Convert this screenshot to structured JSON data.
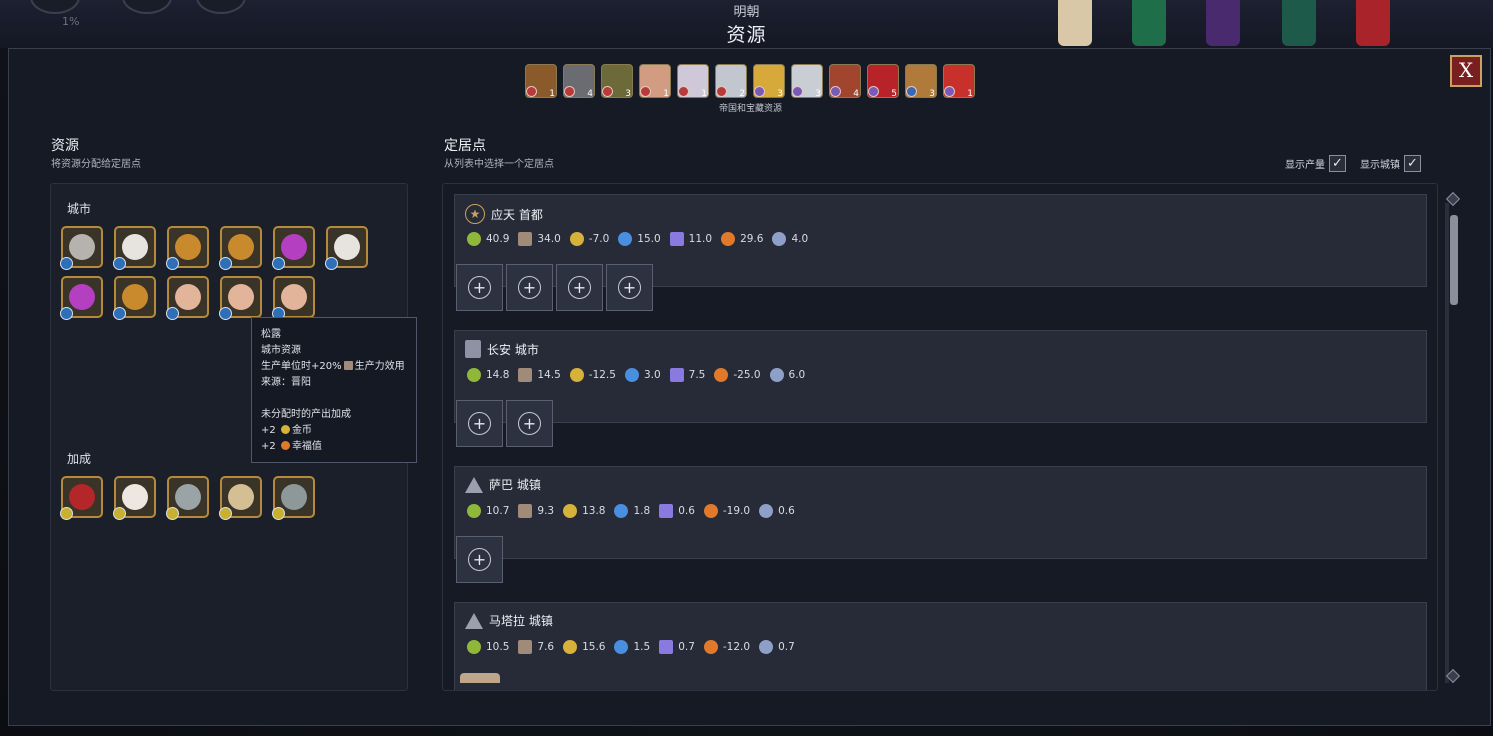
{
  "header": {
    "empire": "明朝",
    "title": "资源",
    "percent": "1%"
  },
  "close": {
    "label": "X"
  },
  "stockpile": {
    "caption": "帝国和宝藏资源",
    "items": [
      {
        "icon": "wood-resource-icon",
        "count": "1",
        "color": "#8b5a2b",
        "badge": "#b83a3a"
      },
      {
        "icon": "iron-resource-icon",
        "count": "4",
        "color": "#6b6b72",
        "badge": "#b83a3a"
      },
      {
        "icon": "wine-resource-icon",
        "count": "3",
        "color": "#6d6a3a",
        "badge": "#b83a3a"
      },
      {
        "icon": "hands-resource-icon",
        "count": "1",
        "color": "#d19c82",
        "badge": "#b83a3a"
      },
      {
        "icon": "salt-resource-icon",
        "count": "1",
        "color": "#cfc8d8",
        "badge": "#b83a3a"
      },
      {
        "icon": "statue-resource-icon",
        "count": "2",
        "color": "#c2c7cf",
        "badge": "#b83a3a"
      },
      {
        "icon": "gold-bars-resource-icon",
        "count": "3",
        "color": "#d6a93a",
        "badge": "#7a5ab8"
      },
      {
        "icon": "teapot-resource-icon",
        "count": "3",
        "color": "#c9cdd4",
        "badge": "#7a5ab8"
      },
      {
        "icon": "books-resource-icon",
        "count": "4",
        "color": "#a1452e",
        "badge": "#7a5ab8"
      },
      {
        "icon": "potion-resource-icon",
        "count": "5",
        "color": "#b8232a",
        "badge": "#7a5ab8"
      },
      {
        "icon": "horse-resource-icon",
        "count": "3",
        "color": "#b07a3a",
        "badge": "#3a68b8"
      },
      {
        "icon": "hat-resource-icon",
        "count": "1",
        "color": "#c8302c",
        "badge": "#7a5ab8"
      }
    ]
  },
  "left": {
    "title": "资源",
    "subtitle": "将资源分配给定居点",
    "city_label": "城市",
    "bonus_label": "加成",
    "city_tiles": [
      {
        "icon": "pearl-oyster-icon",
        "color": "#b6b2ae"
      },
      {
        "icon": "rice-bowl-icon",
        "color": "#e7e4e0"
      },
      {
        "icon": "tea-cake-icon",
        "color": "#c98a2e"
      },
      {
        "icon": "tea-cake-icon",
        "color": "#c98a2e"
      },
      {
        "icon": "silk-roll-icon",
        "color": "#b43fc0"
      },
      {
        "icon": "rice-bowl-icon",
        "color": "#e7e4e0"
      },
      {
        "icon": "silk-roll-icon",
        "color": "#b43fc0"
      },
      {
        "icon": "tea-cake-icon",
        "color": "#c98a2e"
      },
      {
        "icon": "pig-icon",
        "color": "#e2b49a"
      },
      {
        "icon": "pig-icon",
        "color": "#e2b49a"
      },
      {
        "icon": "pig-icon",
        "color": "#e2b49a"
      }
    ],
    "bonus_tiles": [
      {
        "icon": "dates-icon",
        "color": "#b3262a"
      },
      {
        "icon": "cotton-icon",
        "color": "#ece7e0"
      },
      {
        "icon": "elephant-icon",
        "color": "#9aa3a6"
      },
      {
        "icon": "camel-icon",
        "color": "#d4bf94"
      },
      {
        "icon": "tin-can-icon",
        "color": "#8d9898"
      }
    ]
  },
  "tooltip": {
    "name": "松露",
    "type": "城市资源",
    "effect_prefix": "生产单位时+20%",
    "effect_suffix": "生产力效用",
    "source": "来源：晋阳",
    "unassigned_title": "未分配时的产出加成",
    "gold_amount": "+2",
    "gold_label": "金币",
    "happy_amount": "+2",
    "happy_label": "幸福值"
  },
  "right": {
    "title": "定居点",
    "subtitle": "从列表中选择一个定居点",
    "show_yield": "显示产量",
    "show_towns": "显示城镇",
    "settlements": [
      {
        "name": "应天 首都",
        "kind": "capital",
        "stats": [
          "40.9",
          "34.0",
          "-7.0",
          "15.0",
          "11.0",
          "29.6",
          "4.0"
        ],
        "slots": 4
      },
      {
        "name": "长安 城市",
        "kind": "city",
        "stats": [
          "14.8",
          "14.5",
          "-12.5",
          "3.0",
          "7.5",
          "-25.0",
          "6.0"
        ],
        "slots": 2
      },
      {
        "name": "萨巴 城镇",
        "kind": "town",
        "stats": [
          "10.7",
          "9.3",
          "13.8",
          "1.8",
          "0.6",
          "-19.0",
          "0.6"
        ],
        "slots": 1
      },
      {
        "name": "马塔拉 城镇",
        "kind": "town",
        "stats": [
          "10.5",
          "7.6",
          "15.6",
          "1.5",
          "0.7",
          "-12.0",
          "0.7"
        ],
        "slots": 0
      }
    ]
  },
  "yield_icons": [
    "food-icon",
    "production-icon",
    "gold-icon",
    "science-icon",
    "culture-icon",
    "happiness-icon",
    "influence-icon"
  ],
  "yield_colors": [
    "#8fb83a",
    "#a08a78",
    "#d6b23a",
    "#4a8ee0",
    "#8a7ae0",
    "#e07a2a",
    "#8fa0c8"
  ]
}
